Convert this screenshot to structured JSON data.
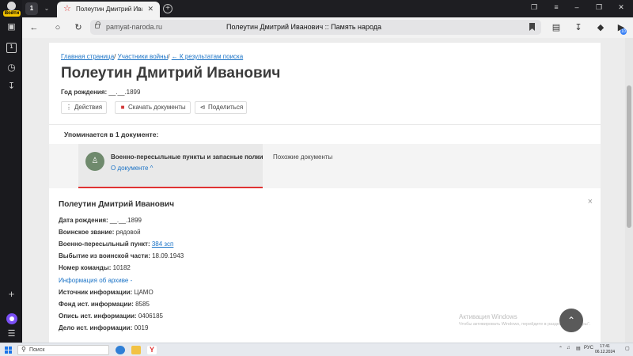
{
  "sidebar": {
    "login_badge": "Войти",
    "counter": "1"
  },
  "browser": {
    "tab_count": "1",
    "tab_title": "Полеутин Дмитрий Иван",
    "url_domain": "pamyat-naroda.ru",
    "page_title": "Полеутин Дмитрий Иванович :: Память народа",
    "ext_badge_count": "10"
  },
  "page": {
    "breadcrumb": {
      "home": "Главная страница",
      "sep1": "/ ",
      "participants": "Участники войны",
      "sep2": "/ ",
      "back": "← К результатам поиска"
    },
    "person_name": "Полеутин Дмитрий Иванович",
    "birth_label": "Год рождения:",
    "birth_value": "__.__.1899",
    "actions": {
      "actions_label": "Действия",
      "download_label": "Скачать документы",
      "share_label": "Поделиться"
    },
    "mentions_text": "Упоминается в 1 документе:",
    "document_tab": {
      "title": "Военно-пересыльные пункты и запасные полки",
      "about_link": "О документе ^"
    },
    "similar_docs": "Похожие документы",
    "detail": {
      "title": "Полеутин Дмитрий Иванович",
      "close": "×",
      "fields": [
        {
          "label": "Дата рождения:",
          "value": "__.__.1899"
        },
        {
          "label": "Воинское звание:",
          "value": "рядовой"
        },
        {
          "label": "Военно-пересыльный пункт:",
          "value": "384 зсп"
        },
        {
          "label": "Выбытие из воинской части:",
          "value": "18.09.1943"
        },
        {
          "label": "Номер команды:",
          "value": "10182"
        }
      ],
      "archive_info": "Информация об архиве -",
      "archive_fields": [
        {
          "label": "Источник информации:",
          "value": "ЦАМО"
        },
        {
          "label": "Фонд ист. информации:",
          "value": "8585"
        },
        {
          "label": "Опись ист. информации:",
          "value": "0406185"
        },
        {
          "label": "Дело ист. информации:",
          "value": "0019"
        }
      ]
    },
    "watermark": {
      "line1": "Активация Windows",
      "line2": "Чтобы активировать Windows, перейдите в раздел \"Параметры\"."
    }
  },
  "taskbar": {
    "search_placeholder": "Поиск",
    "lang": "РУС",
    "time": "17:41",
    "date": "06.12.2024"
  },
  "colors": {
    "link": "#1b73c6",
    "accent_red": "#e03333",
    "doc_icon": "#6f8a6d"
  }
}
